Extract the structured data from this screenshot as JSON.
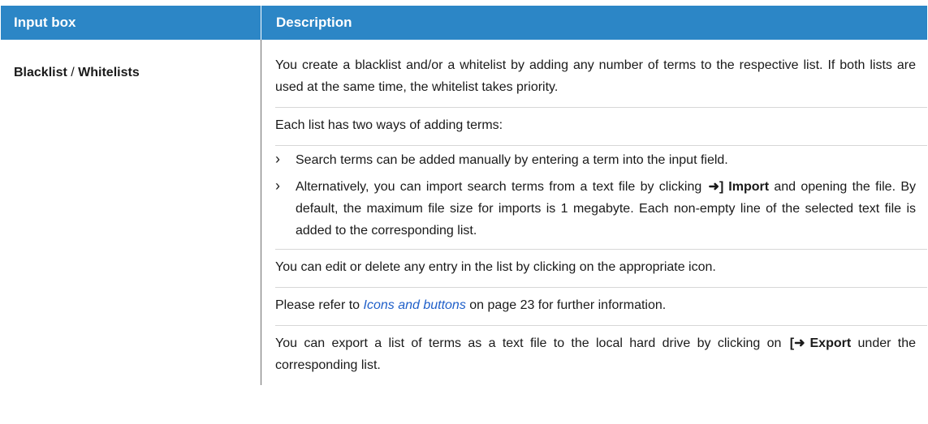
{
  "table": {
    "headers": {
      "input_box": "Input box",
      "description": "Description"
    },
    "row": {
      "label_part1": "Blacklist",
      "label_sep": " / ",
      "label_part2": "Whitelists",
      "p1": "You create a blacklist and/or a whitelist by adding any number of terms to the respective list. If both lists are used at the same time, the whitelist takes priority.",
      "p2": "Each list has two ways of adding terms:",
      "bullet1": "Search terms can be added manually by entering a term into the input field.",
      "bullet2_before": "Alternatively, you can import search terms from a text file by clicking",
      "bullet2_icon": "import-icon",
      "bullet2_bold": "Import",
      "bullet2_after": "and opening the file. By default, the maximum file size for imports is 1 megabyte. Each non-empty line of the selected text file is added to the corresponding list.",
      "p3": "You can edit or delete any entry in the list by clicking on the appropriate icon.",
      "p4_before": "Please refer to",
      "p4_link": "Icons and buttons",
      "p4_after": "on page 23 for further information.",
      "p5_before": "You can export a list of terms as a text file to the local hard drive by clicking on",
      "p5_icon": "export-icon",
      "p5_bold": "Export",
      "p5_after": "under the corresponding list."
    }
  },
  "colors": {
    "header_bg": "#2c86c6",
    "link": "#1f5fc9"
  }
}
